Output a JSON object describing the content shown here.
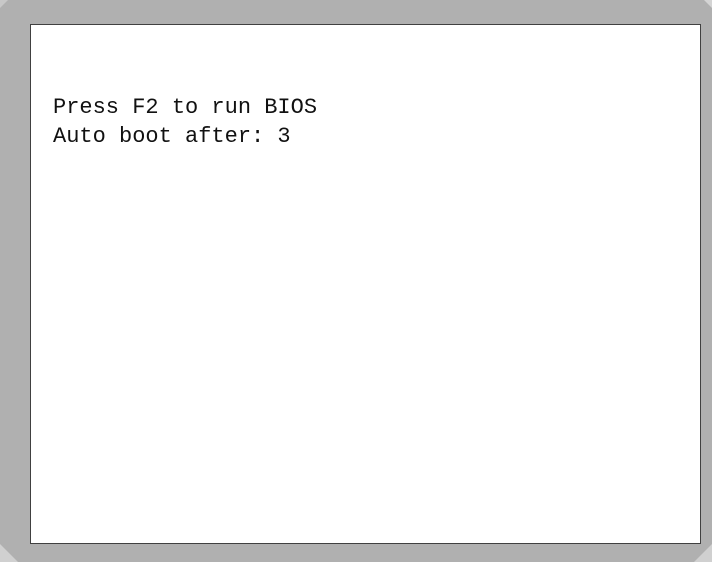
{
  "screen": {
    "lines": [
      "Press F2 to run BIOS",
      "Auto boot after: 3"
    ]
  },
  "colors": {
    "bezel": "#b0b0b0",
    "screen_background": "#ffffff",
    "text": "#111111"
  }
}
